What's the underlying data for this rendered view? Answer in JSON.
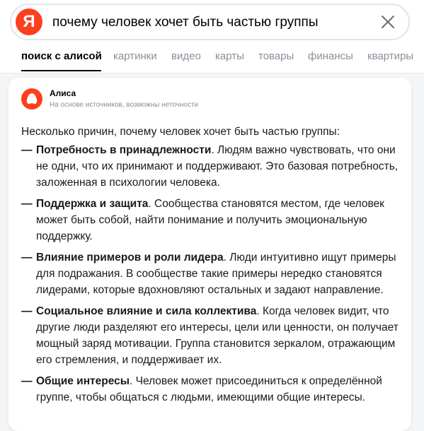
{
  "search": {
    "logo_letter": "Я",
    "query": "почему человек хочет быть частью группы"
  },
  "tabs": [
    {
      "label": "поиск с алисой",
      "active": true
    },
    {
      "label": "картинки"
    },
    {
      "label": "видео"
    },
    {
      "label": "карты"
    },
    {
      "label": "товары"
    },
    {
      "label": "финансы"
    },
    {
      "label": "квартиры"
    }
  ],
  "answer": {
    "source_name": "Алиса",
    "disclaimer": "На основе источников, возможны неточности",
    "intro": "Несколько причин, почему человек хочет быть частью группы:",
    "dash": "—",
    "items": [
      {
        "title": "Потребность в принадлежности",
        "text": ". Людям важно чувствовать, что они не одни, что их принимают и поддерживают. Это базовая потребность, заложенная в психологии человека."
      },
      {
        "title": "Поддержка и защита",
        "text": ". Сообщества становятся местом, где человек может быть собой, найти понимание и получить эмоциональную поддержку."
      },
      {
        "title": "Влияние примеров и роли лидера",
        "text": ". Люди интуитивно ищут примеры для подражания. В сообществе такие примеры нередко становятся лидерами, которые вдохновляют остальных и задают направление."
      },
      {
        "title": "Социальное влияние и сила коллектива",
        "text": ". Когда человек видит, что другие люди разделяют его интересы, цели или ценности, он получает мощный заряд мотивации. Группа становится зеркалом, отражающим его стремления, и поддерживает их."
      },
      {
        "title": "Общие интересы",
        "text": ". Человек может присоединиться к определённой группе, чтобы общаться с людьми, имеющими общие интересы."
      }
    ]
  },
  "colors": {
    "brand": "#fc3f1d",
    "active_tab": "#000000",
    "inactive_tab": "#8a8f99"
  },
  "icons": {
    "clear": "close-icon",
    "alice": "alice-logo-icon"
  }
}
